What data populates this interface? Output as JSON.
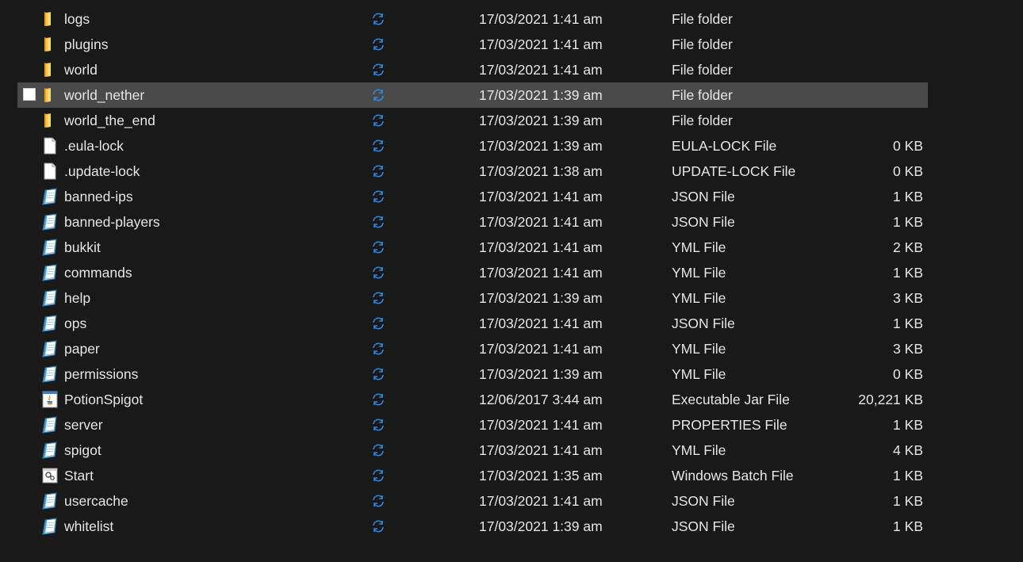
{
  "colors": {
    "background": "#191919",
    "selected_row": "#4a4a4a",
    "text": "#e6e6e6",
    "sync_blue": "#2f8cde",
    "folder_yellow": "#f0c24a"
  },
  "files": [
    {
      "name": "logs",
      "icon": "folder-icon",
      "date": "17/03/2021 1:41 am",
      "type": "File folder",
      "size": "",
      "selected": false
    },
    {
      "name": "plugins",
      "icon": "folder-icon",
      "date": "17/03/2021 1:41 am",
      "type": "File folder",
      "size": "",
      "selected": false
    },
    {
      "name": "world",
      "icon": "folder-icon",
      "date": "17/03/2021 1:41 am",
      "type": "File folder",
      "size": "",
      "selected": false
    },
    {
      "name": "world_nether",
      "icon": "folder-icon",
      "date": "17/03/2021 1:39 am",
      "type": "File folder",
      "size": "",
      "selected": true
    },
    {
      "name": "world_the_end",
      "icon": "folder-icon",
      "date": "17/03/2021 1:39 am",
      "type": "File folder",
      "size": "",
      "selected": false
    },
    {
      "name": ".eula-lock",
      "icon": "blank-file-icon",
      "date": "17/03/2021 1:39 am",
      "type": "EULA-LOCK File",
      "size": "0 KB",
      "selected": false
    },
    {
      "name": ".update-lock",
      "icon": "blank-file-icon",
      "date": "17/03/2021 1:38 am",
      "type": "UPDATE-LOCK File",
      "size": "0 KB",
      "selected": false
    },
    {
      "name": "banned-ips",
      "icon": "notepad-file-icon",
      "date": "17/03/2021 1:41 am",
      "type": "JSON File",
      "size": "1 KB",
      "selected": false
    },
    {
      "name": "banned-players",
      "icon": "notepad-file-icon",
      "date": "17/03/2021 1:41 am",
      "type": "JSON File",
      "size": "1 KB",
      "selected": false
    },
    {
      "name": "bukkit",
      "icon": "notepad-file-icon",
      "date": "17/03/2021 1:41 am",
      "type": "YML File",
      "size": "2 KB",
      "selected": false
    },
    {
      "name": "commands",
      "icon": "notepad-file-icon",
      "date": "17/03/2021 1:41 am",
      "type": "YML File",
      "size": "1 KB",
      "selected": false
    },
    {
      "name": "help",
      "icon": "notepad-file-icon",
      "date": "17/03/2021 1:39 am",
      "type": "YML File",
      "size": "3 KB",
      "selected": false
    },
    {
      "name": "ops",
      "icon": "notepad-file-icon",
      "date": "17/03/2021 1:41 am",
      "type": "JSON File",
      "size": "1 KB",
      "selected": false
    },
    {
      "name": "paper",
      "icon": "notepad-file-icon",
      "date": "17/03/2021 1:41 am",
      "type": "YML File",
      "size": "3 KB",
      "selected": false
    },
    {
      "name": "permissions",
      "icon": "notepad-file-icon",
      "date": "17/03/2021 1:39 am",
      "type": "YML File",
      "size": "0 KB",
      "selected": false
    },
    {
      "name": "PotionSpigot",
      "icon": "java-jar-icon",
      "date": "12/06/2017 3:44 am",
      "type": "Executable Jar File",
      "size": "20,221 KB",
      "selected": false
    },
    {
      "name": "server",
      "icon": "notepad-file-icon",
      "date": "17/03/2021 1:41 am",
      "type": "PROPERTIES File",
      "size": "1 KB",
      "selected": false
    },
    {
      "name": "spigot",
      "icon": "notepad-file-icon",
      "date": "17/03/2021 1:41 am",
      "type": "YML File",
      "size": "4 KB",
      "selected": false
    },
    {
      "name": "Start",
      "icon": "batch-file-icon",
      "date": "17/03/2021 1:35 am",
      "type": "Windows Batch File",
      "size": "1 KB",
      "selected": false
    },
    {
      "name": "usercache",
      "icon": "notepad-file-icon",
      "date": "17/03/2021 1:41 am",
      "type": "JSON File",
      "size": "1 KB",
      "selected": false
    },
    {
      "name": "whitelist",
      "icon": "notepad-file-icon",
      "date": "17/03/2021 1:39 am",
      "type": "JSON File",
      "size": "1 KB",
      "selected": false
    }
  ]
}
